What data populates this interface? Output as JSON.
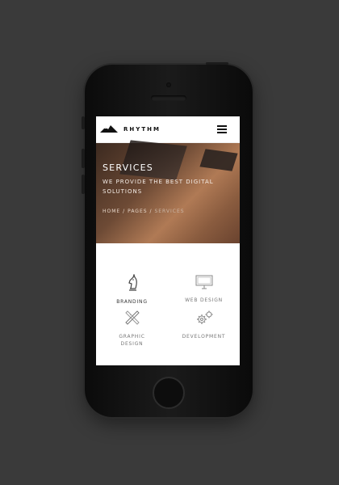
{
  "app": {
    "brand": "RHYTHM"
  },
  "hero": {
    "title": "SERVICES",
    "subtitle": "WE PROVIDE THE BEST DIGITAL SOLUTIONS",
    "breadcrumb": [
      "HOME",
      "/",
      "PAGES",
      "/",
      "SERVICES"
    ]
  },
  "services": [
    {
      "label": "BRANDING",
      "icon": "chess-knight-icon"
    },
    {
      "label": "WEB DESIGN",
      "icon": "monitor-icon"
    },
    {
      "label": "GRAPHIC\nDESIGN",
      "icon": "pencil-ruler-icon"
    },
    {
      "label": "DEVELOPMENT",
      "icon": "gears-icon"
    }
  ],
  "colors": {
    "background": "#3a3a3a",
    "phone": "#111111",
    "accent_text": "#777777"
  }
}
